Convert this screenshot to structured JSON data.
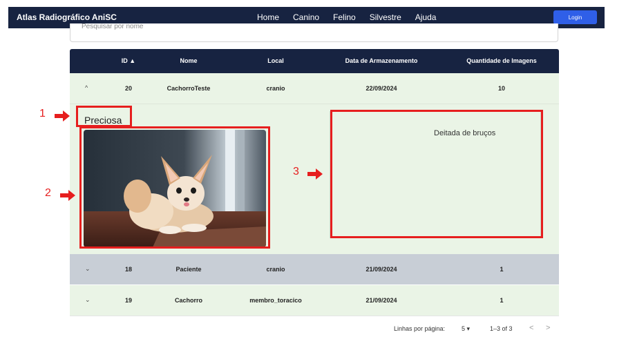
{
  "app": {
    "brand": "Atlas Radiográfico AniSC",
    "nav": [
      "Home",
      "Canino",
      "Felino",
      "Silvestre",
      "Ajuda"
    ],
    "login_label": "Login"
  },
  "search": {
    "placeholder": "Pesquisar por nome"
  },
  "table": {
    "headers": [
      "ID ▲",
      "Nome",
      "Local",
      "Data de Armazenamento",
      "Quantidade de Imagens"
    ],
    "rows": [
      {
        "id": "20",
        "nome": "CachorroTeste",
        "local": "cranio",
        "data": "22/09/2024",
        "qtd": "10",
        "expanded": true,
        "chevron": "^"
      },
      {
        "id": "18",
        "nome": "Paciente",
        "local": "cranio",
        "data": "21/09/2024",
        "qtd": "1",
        "expanded": false,
        "chevron": "⌄"
      },
      {
        "id": "19",
        "nome": "Cachorro",
        "local": "membro_toracico",
        "data": "21/09/2024",
        "qtd": "1",
        "expanded": false,
        "chevron": "⌄"
      }
    ],
    "detail": {
      "name": "Preciosa",
      "description": "Deitada de bruços"
    }
  },
  "annotations": [
    "1",
    "2",
    "3"
  ],
  "pagination": {
    "rows_label": "Linhas por página:",
    "rows_value": "5",
    "range": "1–3 of 3",
    "prev": "<",
    "next": ">"
  },
  "colors": {
    "nav_bg": "#172341",
    "login_bg": "#2f5fe8",
    "row_expanded_bg": "#eaf4e6",
    "row_selected_bg": "#c8ced6",
    "annotation_red": "#e61e1e"
  }
}
